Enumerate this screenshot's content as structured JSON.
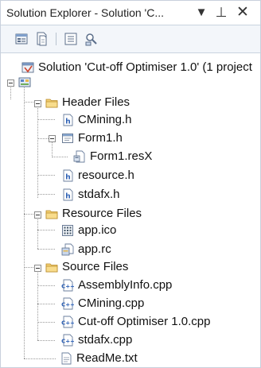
{
  "window": {
    "title": "Solution Explorer - Solution 'C...",
    "menu_icon": "dropdown-arrow-icon",
    "pin_icon": "pin-icon",
    "close_icon": "close-icon"
  },
  "toolbar": {
    "buttons": [
      "properties-icon",
      "show-all-files-icon",
      "refresh-icon",
      "view-class-diagram-icon"
    ]
  },
  "tree": {
    "solution_label": "Solution 'Cut-off Optimiser 1.0' (1 project",
    "project_label": "",
    "header_files": {
      "label": "Header Files",
      "items": {
        "cmining_h": "CMining.h",
        "form1_h": "Form1.h",
        "form1_resx": "Form1.resX",
        "resource_h": "resource.h",
        "stdafx_h": "stdafx.h"
      }
    },
    "resource_files": {
      "label": "Resource Files",
      "items": {
        "app_ico": "app.ico",
        "app_rc": "app.rc"
      }
    },
    "source_files": {
      "label": "Source Files",
      "items": {
        "assemblyinfo_cpp": "AssemblyInfo.cpp",
        "cmining_cpp": "CMining.cpp",
        "cutoff_cpp": "Cut-off Optimiser 1.0.cpp",
        "stdafx_cpp": "stdafx.cpp"
      }
    },
    "readme": "ReadMe.txt"
  },
  "colors": {
    "folder": "#e8b84a",
    "header_file": "#2b5fb4",
    "cpp_file": "#2b5fb4"
  }
}
